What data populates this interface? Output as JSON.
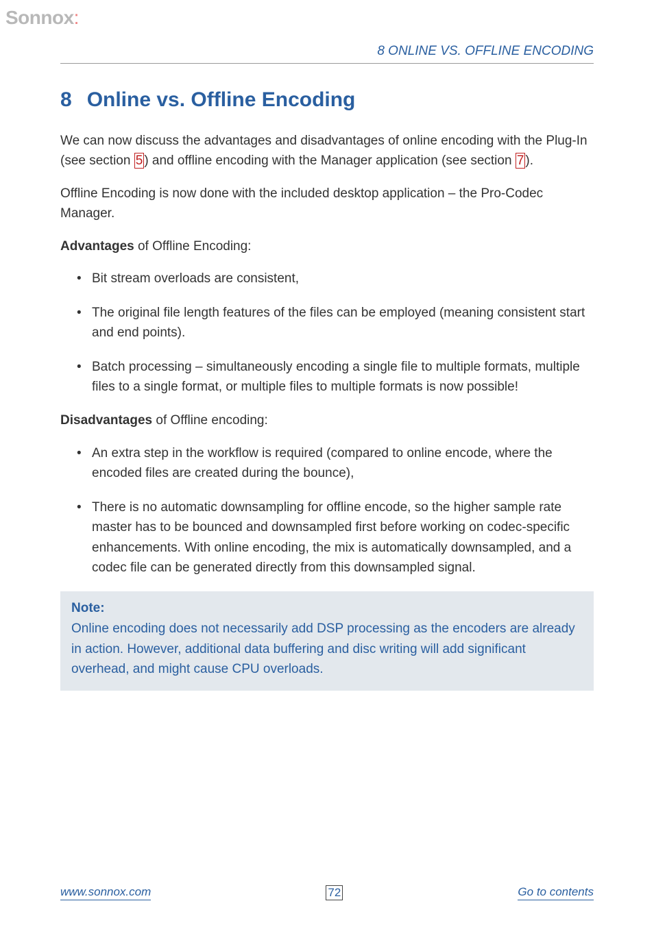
{
  "logo": {
    "text": "Sonnox",
    "accent": ":"
  },
  "runningHeader": "8    ONLINE VS. OFFLINE ENCODING",
  "section": {
    "number": "8",
    "title": "Online vs. Offline Encoding"
  },
  "intro": {
    "part1": "We can now discuss the advantages and disadvantages of online encoding with the Plug-In (see section ",
    "link1": "5",
    "part2": ") and offline encoding with the Manager application (see section ",
    "link2": "7",
    "part3": ")."
  },
  "offlineDesc": "Offline Encoding is now done with the included desktop application – the Pro-Codec Manager.",
  "advantages": {
    "label": "Advantages",
    "suffix": " of Offline Encoding:",
    "items": [
      "Bit stream overloads are consistent,",
      "The original file length features of the files can be employed (meaning consistent start and end points).",
      "Batch processing – simultaneously encoding a single file to multiple formats, multiple files to a single format, or multiple files to multiple formats is now possible!"
    ]
  },
  "disadvantages": {
    "label": "Disadvantages",
    "suffix": " of Offline encoding:",
    "items": [
      "An extra step in the workflow is required (compared to online encode, where the encoded files are created during the bounce),",
      "There is no automatic downsampling for offline encode, so the higher sample rate master has to be bounced and downsampled first before working on codec-specific enhancements. With online encoding, the mix is automatically downsampled, and a codec file can be generated directly from this downsampled signal."
    ]
  },
  "note": {
    "title": "Note:",
    "body": "Online encoding does not necessarily add DSP processing as the encoders are already in action. However, additional data buffering and disc writing will add significant overhead, and might cause CPU overloads."
  },
  "footer": {
    "left": "www.sonnox.com",
    "center": "72",
    "right": "Go to contents"
  }
}
